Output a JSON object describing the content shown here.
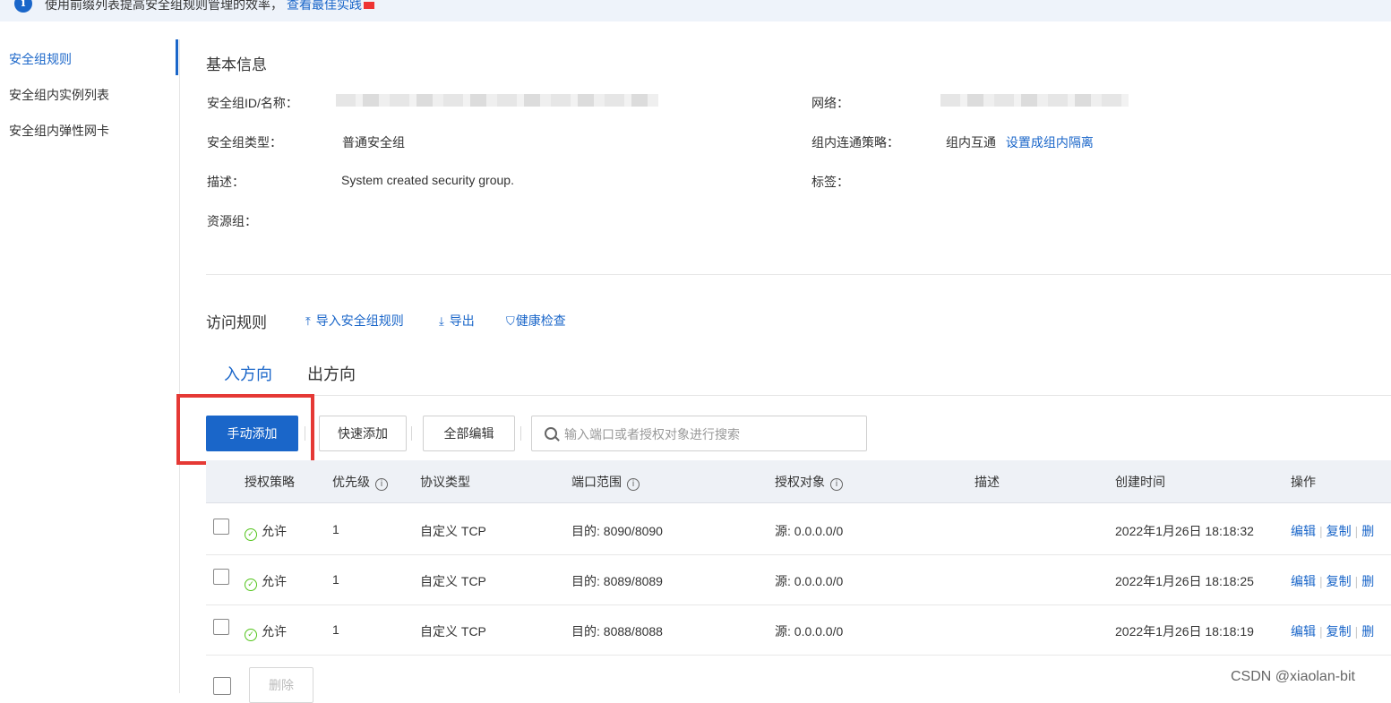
{
  "notice": {
    "text": "使用前缀列表提高安全组规则管理的效率，",
    "link": "查看最佳实践"
  },
  "sidebar": {
    "items": [
      {
        "label": "安全组规则",
        "active": true
      },
      {
        "label": "安全组内实例列表",
        "active": false
      },
      {
        "label": "安全组内弹性网卡",
        "active": false
      }
    ]
  },
  "basic_info": {
    "title": "基本信息",
    "id_label": "安全组ID/名称：",
    "network_label": "网络：",
    "type_label": "安全组类型：",
    "type_value": "普通安全组",
    "policy_label": "组内连通策略：",
    "policy_value": "组内互通",
    "policy_link": "设置成组内隔离",
    "desc_label": "描述：",
    "desc_value": "System created security group.",
    "tags_label": "标签：",
    "resource_group_label": "资源组："
  },
  "access_rules": {
    "title": "访问规则",
    "import_label": "导入安全组规则",
    "export_label": "导出",
    "health_label": "健康检查"
  },
  "tabs": [
    {
      "label": "入方向",
      "active": true
    },
    {
      "label": "出方向",
      "active": false
    }
  ],
  "actions": {
    "manual_add": "手动添加",
    "quick_add": "快速添加",
    "edit_all": "全部编辑",
    "search_placeholder": "输入端口或者授权对象进行搜索"
  },
  "table": {
    "headers": {
      "policy": "授权策略",
      "priority": "优先级",
      "protocol": "协议类型",
      "port": "端口范围",
      "target": "授权对象",
      "desc": "描述",
      "created": "创建时间",
      "ops": "操作"
    },
    "rows": [
      {
        "policy": "允许",
        "priority": "1",
        "protocol": "自定义 TCP",
        "port": "目的: 8090/8090",
        "target": "源: 0.0.0.0/0",
        "created": "2022年1月26日 18:18:32",
        "edit": "编辑",
        "copy": "复制",
        "delete": "删"
      },
      {
        "policy": "允许",
        "priority": "1",
        "protocol": "自定义 TCP",
        "port": "目的: 8089/8089",
        "target": "源: 0.0.0.0/0",
        "created": "2022年1月26日 18:18:25",
        "edit": "编辑",
        "copy": "复制",
        "delete": "删"
      },
      {
        "policy": "允许",
        "priority": "1",
        "protocol": "自定义 TCP",
        "port": "目的: 8088/8088",
        "target": "源: 0.0.0.0/0",
        "created": "2022年1月26日 18:18:19",
        "edit": "编辑",
        "copy": "复制",
        "delete": "删"
      }
    ],
    "footer_delete": "删除"
  },
  "watermark": "CSDN @xiaolan-bit",
  "colors": {
    "accent": "#1a66c9",
    "highlight": "#e53935",
    "allow": "#52c41a"
  }
}
